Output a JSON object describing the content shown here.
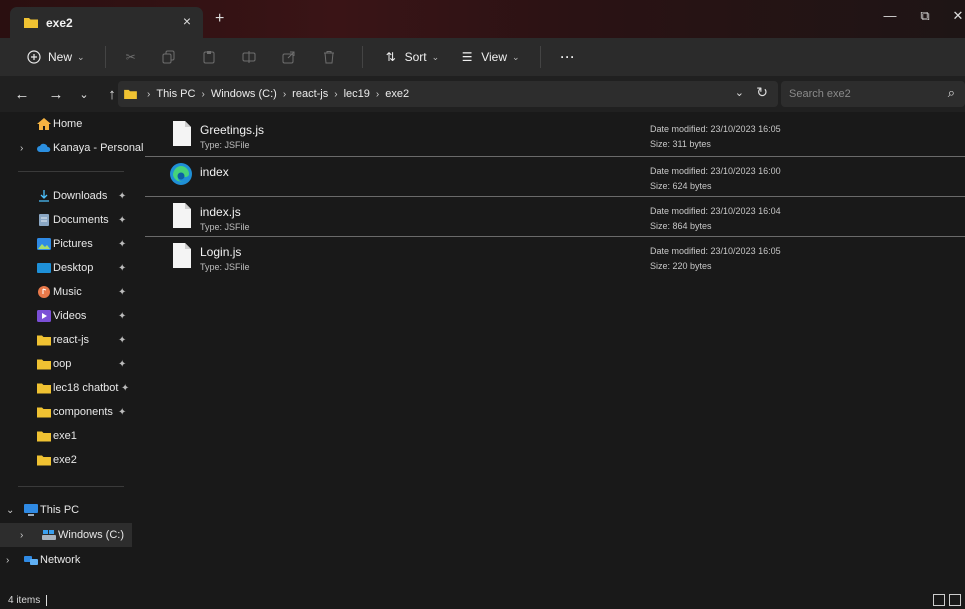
{
  "window": {
    "tab_title": "exe2",
    "tab_close_icon": "×",
    "new_tab_icon": "+",
    "minimize_icon": "—",
    "maximize_icon": "⧉",
    "close_icon": "✕"
  },
  "toolbar": {
    "new_label": "New",
    "sort_label": "Sort",
    "view_label": "View",
    "more_label": "···"
  },
  "address": {
    "crumbs": [
      "This PC",
      "Windows (C:)",
      "react-js",
      "lec19",
      "exe2"
    ],
    "search_placeholder": "Search exe2"
  },
  "sidebar": {
    "items": [
      {
        "label": "Home",
        "icon": "home-icon"
      },
      {
        "label": "Kanaya - Personal",
        "icon": "cloud-icon"
      },
      {
        "label": "Downloads",
        "icon": "download-icon"
      },
      {
        "label": "Documents",
        "icon": "documents-icon"
      },
      {
        "label": "Pictures",
        "icon": "pictures-icon"
      },
      {
        "label": "Desktop",
        "icon": "desktop-icon"
      },
      {
        "label": "Music",
        "icon": "music-icon"
      },
      {
        "label": "Videos",
        "icon": "videos-icon"
      },
      {
        "label": "react-js",
        "icon": "folder-icon"
      },
      {
        "label": "oop",
        "icon": "folder-icon"
      },
      {
        "label": "lec18 chatbot",
        "icon": "folder-icon"
      },
      {
        "label": "components",
        "icon": "folder-icon"
      },
      {
        "label": "exe1",
        "icon": "folder-icon"
      },
      {
        "label": "exe2",
        "icon": "folder-icon"
      },
      {
        "label": "This PC",
        "icon": "computer-icon"
      },
      {
        "label": "Windows (C:)",
        "icon": "drive-icon"
      },
      {
        "label": "Network",
        "icon": "network-icon"
      }
    ]
  },
  "files": [
    {
      "name": "Greetings.js",
      "type": "Type: JSFile",
      "date": "Date modified: 23/10/2023 16:05",
      "size": "Size: 311 bytes",
      "icon": "file-icon"
    },
    {
      "name": "index",
      "type": "",
      "date": "Date modified: 23/10/2023 16:00",
      "size": "Size: 624 bytes",
      "icon": "edge-icon"
    },
    {
      "name": "index.js",
      "type": "Type: JSFile",
      "date": "Date modified: 23/10/2023 16:04",
      "size": "Size: 864 bytes",
      "icon": "file-icon"
    },
    {
      "name": "Login.js",
      "type": "Type: JSFile",
      "date": "Date modified: 23/10/2023 16:05",
      "size": "Size: 220 bytes",
      "icon": "file-icon"
    }
  ],
  "status": {
    "item_count": "4 items"
  },
  "colors": {
    "folder": "#f0c232",
    "accent": "#4cc2ff"
  }
}
